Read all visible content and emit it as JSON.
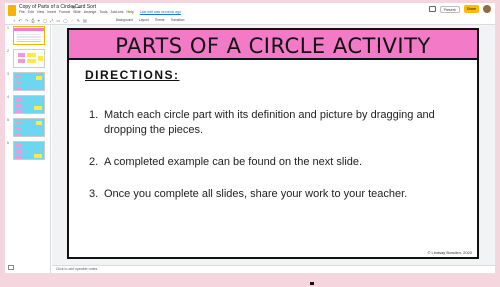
{
  "doc": {
    "title": "Copy of Parts of a Circle Card Sort",
    "last_edit": "Last edit was seconds ago"
  },
  "menu": [
    "File",
    "Edit",
    "View",
    "Insert",
    "Format",
    "Slide",
    "Arrange",
    "Tools",
    "Add-ons",
    "Help"
  ],
  "header_buttons": {
    "present": "Present",
    "share": "Share"
  },
  "toolbar": {
    "background": "Background",
    "layout": "Layout",
    "theme": "Theme",
    "transition": "Transition"
  },
  "filmstrip": {
    "numbers": [
      "1",
      "2",
      "3",
      "4",
      "5",
      "6"
    ]
  },
  "slide": {
    "title": "PARTS OF A CIRCLE ACTIVITY",
    "directions_heading": "DIRECTIONS:",
    "steps": [
      {
        "num": "1.",
        "text": "Match each circle part with its definition and picture by dragging and dropping the pieces."
      },
      {
        "num": "2.",
        "text": "A completed example can be found on the next slide."
      },
      {
        "num": "3.",
        "text": "Once you complete all slides, share your work to your teacher."
      }
    ],
    "credit": "© Lindsay Bowden, 2020"
  },
  "notes": {
    "placeholder": "Click to add speaker notes"
  },
  "colors": {
    "title_band": "#f27ac6",
    "share_button": "#fbbc04",
    "thumb_blue": "#6fd6f2",
    "page_bg": "#f6d6de"
  }
}
